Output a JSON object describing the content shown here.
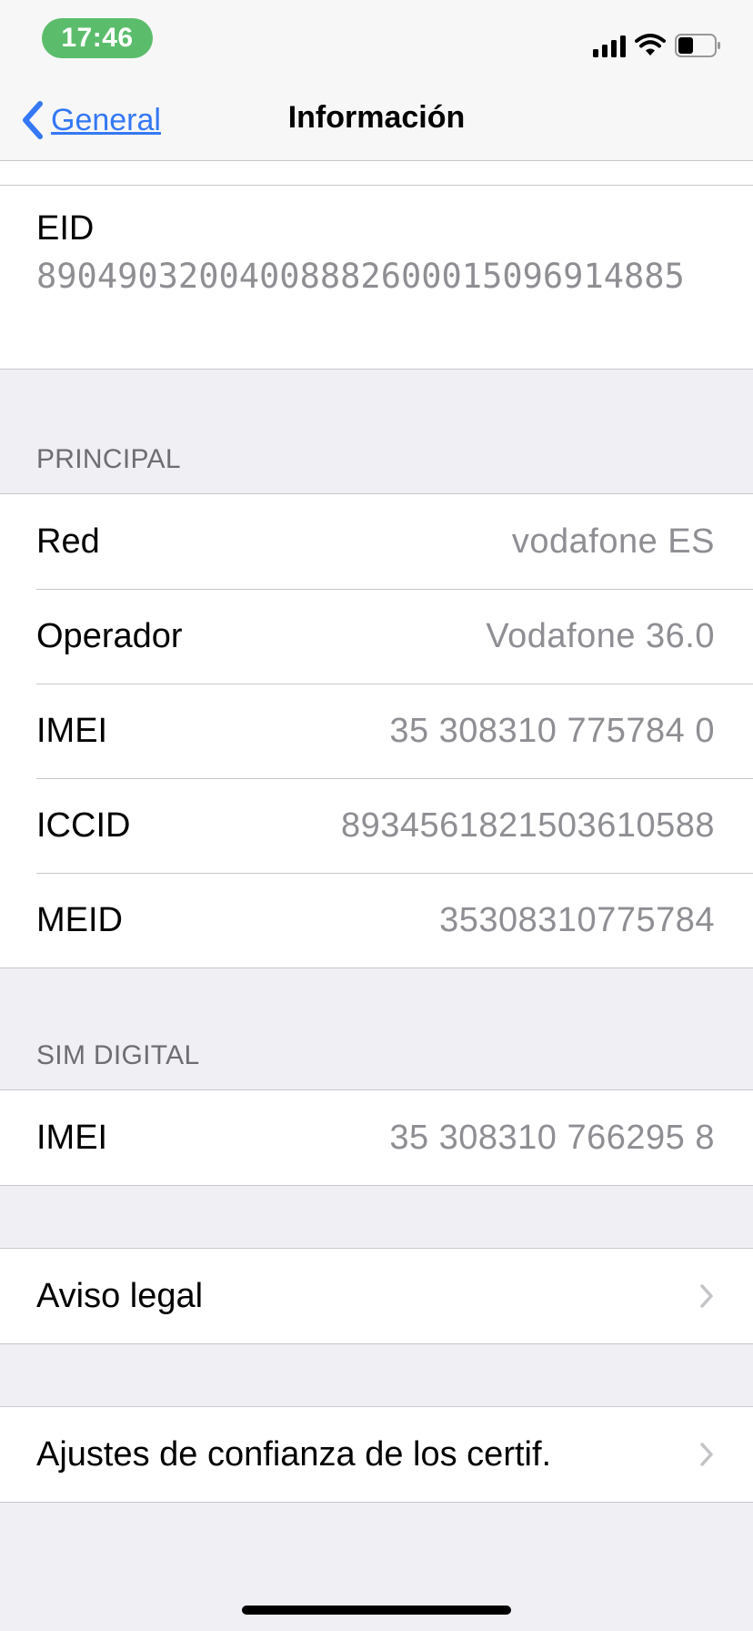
{
  "status_bar": {
    "time": "17:46"
  },
  "nav": {
    "back_label": "General",
    "title": "Información"
  },
  "eid": {
    "label": "EID",
    "value": "89049032004008882600015096914885"
  },
  "principal": {
    "header": "PRINCIPAL",
    "rows": [
      {
        "label": "Red",
        "value": "vodafone ES"
      },
      {
        "label": "Operador",
        "value": "Vodafone 36.0"
      },
      {
        "label": "IMEI",
        "value": "35 308310 775784 0"
      },
      {
        "label": "ICCID",
        "value": "8934561821503610588"
      },
      {
        "label": "MEID",
        "value": "35308310775784"
      }
    ]
  },
  "sim_digital": {
    "header": "SIM DIGITAL",
    "rows": [
      {
        "label": "IMEI",
        "value": "35 308310 766295 8"
      }
    ]
  },
  "links": {
    "legal": "Aviso legal",
    "cert_trust": "Ajustes de confianza de los certif."
  },
  "colors": {
    "accent": "#3478f6",
    "time_pill": "#5bbd6b",
    "secondary_text": "#8e8e93",
    "background": "#efeff4"
  }
}
